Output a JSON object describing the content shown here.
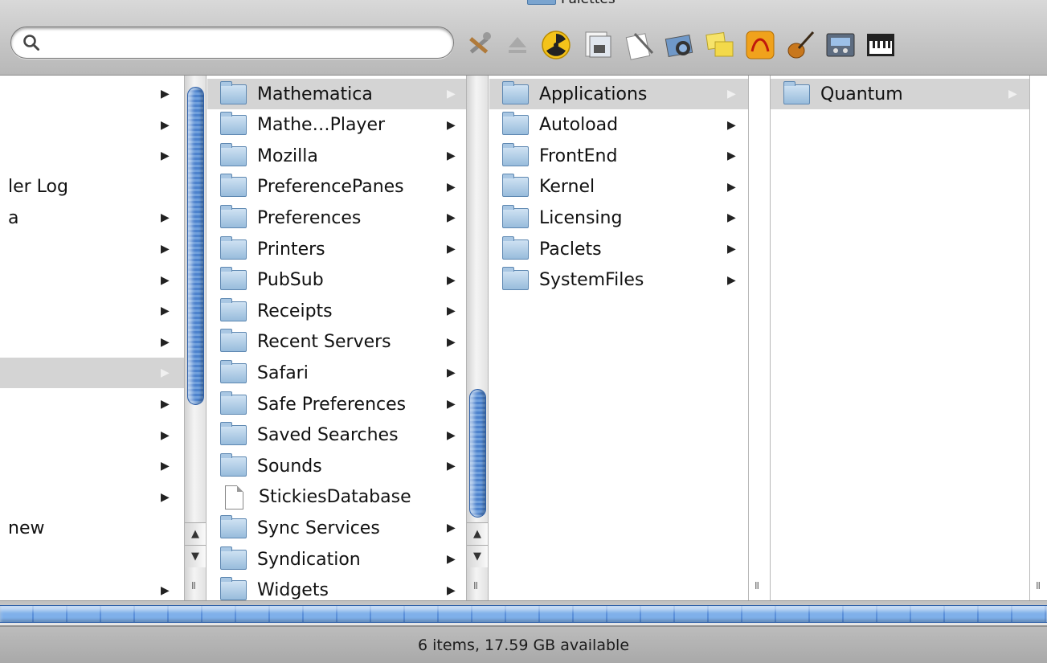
{
  "window": {
    "title": "Palettes"
  },
  "search": {
    "value": "",
    "placeholder": ""
  },
  "toolbar": {
    "icons": [
      "utilities-icon",
      "eject-icon",
      "radiation-icon",
      "preview-icon",
      "textedit-icon",
      "iphoto-icon",
      "stickies-icon",
      "mathematica-icon",
      "garageband-guitar-icon",
      "control-panel-icon",
      "piano-keyboard-icon"
    ]
  },
  "column1": {
    "rows": [
      {
        "label": "",
        "arrow": true
      },
      {
        "label": "",
        "arrow": true
      },
      {
        "label": "",
        "arrow": true
      },
      {
        "label": "ler Log",
        "arrow": false
      },
      {
        "label": "a",
        "arrow": true
      },
      {
        "label": "",
        "arrow": true
      },
      {
        "label": "",
        "arrow": true
      },
      {
        "label": "",
        "arrow": true
      },
      {
        "label": "",
        "arrow": true
      },
      {
        "label": "",
        "arrow": true,
        "selected": true
      },
      {
        "label": "",
        "arrow": true
      },
      {
        "label": "",
        "arrow": true
      },
      {
        "label": "",
        "arrow": true
      },
      {
        "label": "",
        "arrow": true
      },
      {
        "label": "new",
        "arrow": false
      },
      {
        "label": "",
        "arrow": false
      },
      {
        "label": "",
        "arrow": true
      }
    ]
  },
  "column2": {
    "rows": [
      {
        "label": "Mathematica",
        "icon": "folder",
        "arrow": true,
        "selected": true
      },
      {
        "label": "Mathe…Player",
        "icon": "folder",
        "arrow": true
      },
      {
        "label": "Mozilla",
        "icon": "folder",
        "arrow": true
      },
      {
        "label": "PreferencePanes",
        "icon": "folder",
        "arrow": true
      },
      {
        "label": "Preferences",
        "icon": "folder",
        "arrow": true
      },
      {
        "label": "Printers",
        "icon": "folder",
        "arrow": true
      },
      {
        "label": "PubSub",
        "icon": "folder",
        "arrow": true
      },
      {
        "label": "Receipts",
        "icon": "folder",
        "arrow": true
      },
      {
        "label": "Recent Servers",
        "icon": "folder",
        "arrow": true
      },
      {
        "label": "Safari",
        "icon": "folder",
        "arrow": true
      },
      {
        "label": "Safe Preferences",
        "icon": "folder",
        "arrow": true
      },
      {
        "label": "Saved Searches",
        "icon": "folder",
        "arrow": true
      },
      {
        "label": "Sounds",
        "icon": "folder",
        "arrow": true
      },
      {
        "label": "StickiesDatabase",
        "icon": "document",
        "arrow": false
      },
      {
        "label": "Sync Services",
        "icon": "folder",
        "arrow": true
      },
      {
        "label": "Syndication",
        "icon": "folder",
        "arrow": true
      },
      {
        "label": "Widgets",
        "icon": "folder",
        "arrow": true
      }
    ]
  },
  "column3": {
    "rows": [
      {
        "label": "Applications",
        "icon": "folder",
        "arrow": true,
        "selected": true
      },
      {
        "label": "Autoload",
        "icon": "folder",
        "arrow": true
      },
      {
        "label": "FrontEnd",
        "icon": "folder",
        "arrow": true
      },
      {
        "label": "Kernel",
        "icon": "folder",
        "arrow": true
      },
      {
        "label": "Licensing",
        "icon": "folder",
        "arrow": true
      },
      {
        "label": "Paclets",
        "icon": "folder",
        "arrow": true
      },
      {
        "label": "SystemFiles",
        "icon": "folder",
        "arrow": true
      }
    ]
  },
  "column4": {
    "rows": [
      {
        "label": "Quantum",
        "icon": "folder",
        "arrow": true,
        "selected": true
      }
    ]
  },
  "status": {
    "text": "6 items, 17.59 GB available"
  },
  "colors": {
    "selection": "#d4d4d4",
    "scroll_thumb": "#5a90da",
    "folder": "#98bcdc"
  }
}
